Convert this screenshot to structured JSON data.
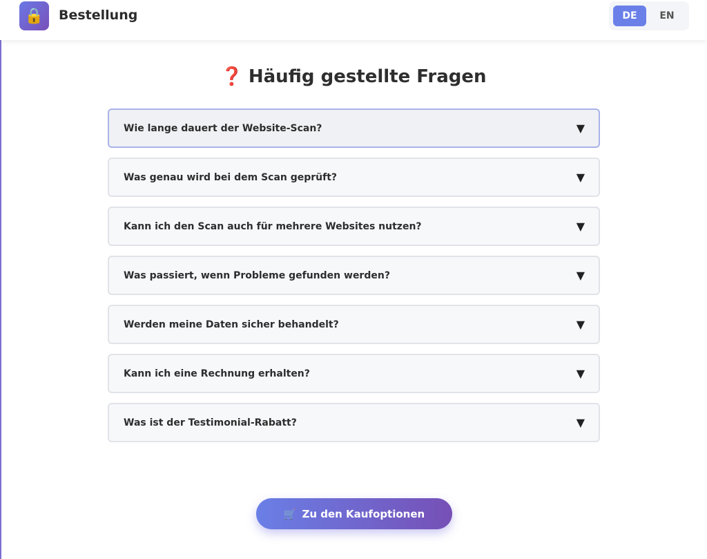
{
  "header": {
    "logo_icon": "lock-icon",
    "logo_glyph": "🔒",
    "brand": "Bestellung",
    "languages": [
      {
        "label": "DE",
        "active": true
      },
      {
        "label": "EN",
        "active": false
      }
    ]
  },
  "faq": {
    "title_icon": "❓",
    "title": "Häufig gestellte Fragen",
    "arrow_glyph": "▼",
    "items": [
      {
        "question": "Wie lange dauert der Website-Scan?",
        "focused": true
      },
      {
        "question": "Was genau wird bei dem Scan geprüft?",
        "focused": false
      },
      {
        "question": "Kann ich den Scan auch für mehrere Websites nutzen?",
        "focused": false
      },
      {
        "question": "Was passiert, wenn Probleme gefunden werden?",
        "focused": false
      },
      {
        "question": "Werden meine Daten sicher behandelt?",
        "focused": false
      },
      {
        "question": "Kann ich eine Rechnung erhalten?",
        "focused": false
      },
      {
        "question": "Was ist der Testimonial-Rabatt?",
        "focused": false
      }
    ]
  },
  "cta": {
    "icon": "🛒",
    "label": "Zu den Kaufoptionen"
  },
  "colors": {
    "accent": "#6a80e8",
    "accent_dark": "#7650b6",
    "focus_border": "#a9b2ea"
  }
}
